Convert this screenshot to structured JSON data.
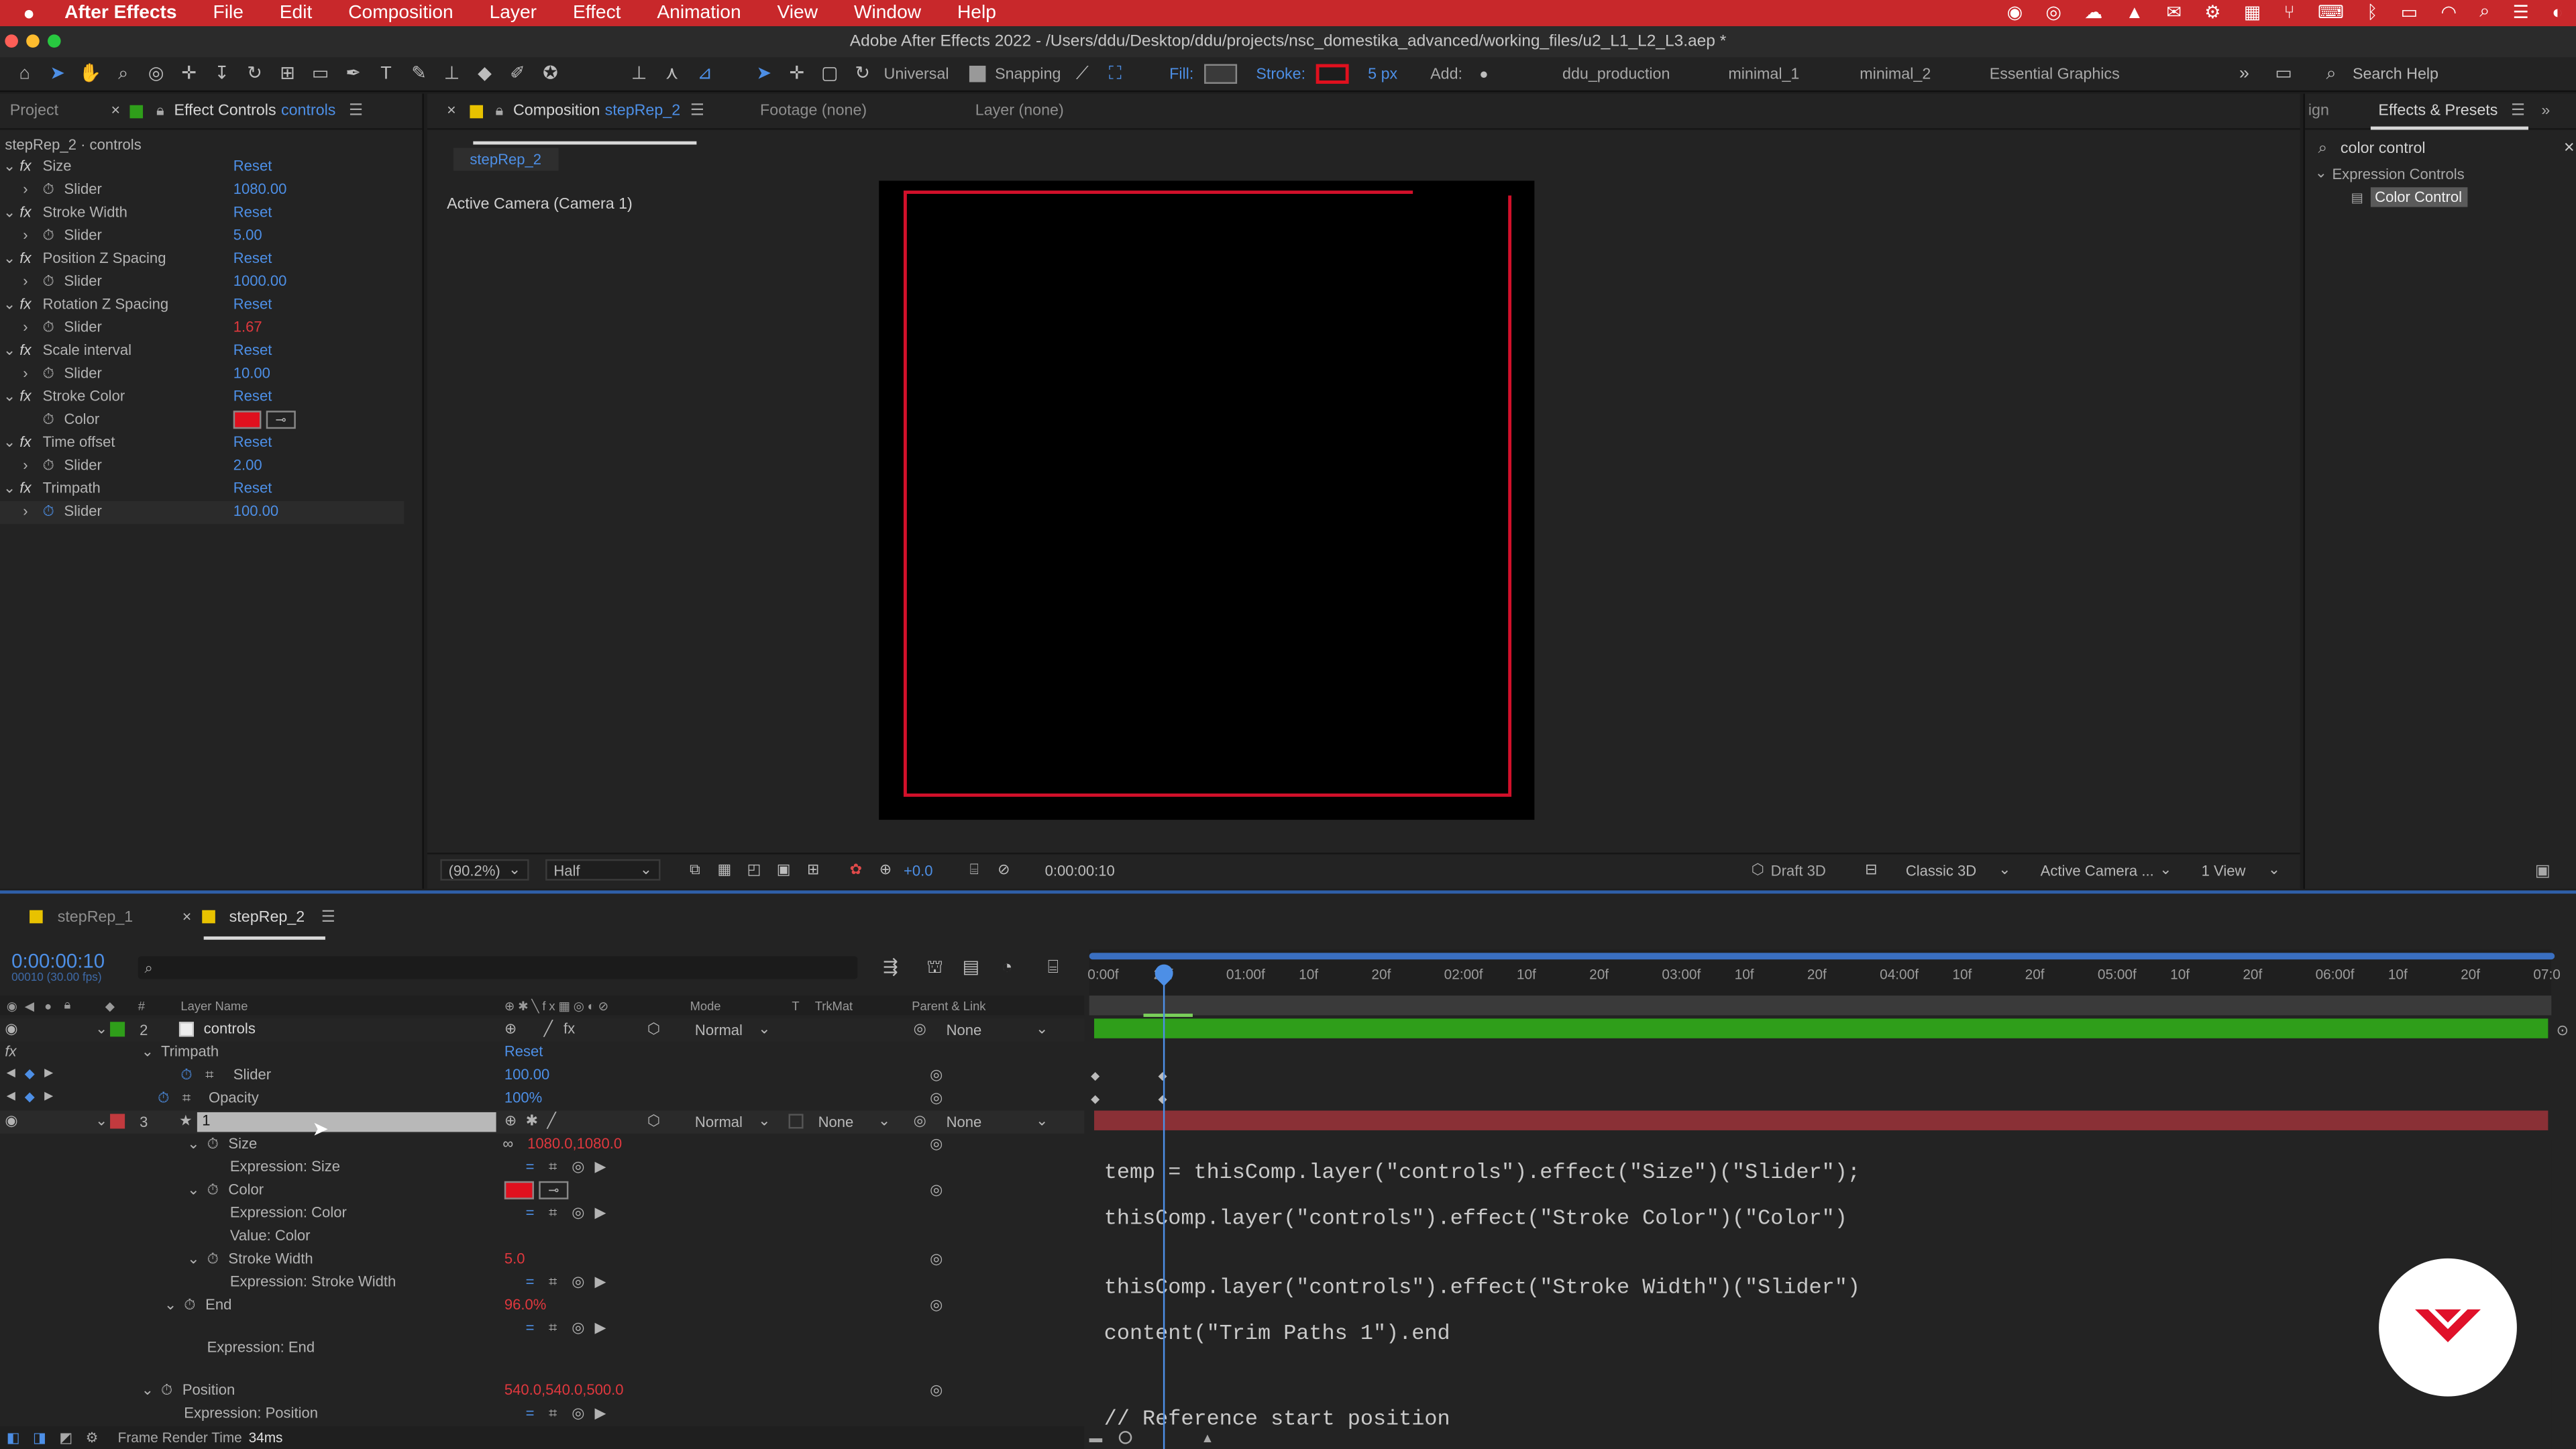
{
  "menubar": {
    "app_name": "After Effects",
    "items": [
      "File",
      "Edit",
      "Composition",
      "Layer",
      "Effect",
      "Animation",
      "View",
      "Window",
      "Help"
    ]
  },
  "titlebar": {
    "title": "Adobe After Effects 2022 - /Users/ddu/Desktop/ddu/projects/nsc_domestika_advanced/working_files/u2_L1_L2_L3.aep *"
  },
  "toolbar": {
    "universal": "Universal",
    "snapping": "Snapping",
    "fill_label": "Fill:",
    "stroke_label": "Stroke:",
    "stroke_width": "5 px",
    "add_label": "Add:",
    "workspaces": [
      "ddu_production",
      "minimal_1",
      "minimal_2",
      "Essential Graphics"
    ],
    "search_placeholder": "Search Help"
  },
  "left_panel": {
    "project_tab": "Project",
    "effect_controls_tab": "Effect Controls",
    "effect_controls_target": "controls",
    "breadcrumb": "stepRep_2 · controls",
    "effects": [
      {
        "name": "Size",
        "reset": "Reset",
        "param": "Slider",
        "value": "1080.00"
      },
      {
        "name": "Stroke Width",
        "reset": "Reset",
        "param": "Slider",
        "value": "5.00"
      },
      {
        "name": "Position Z Spacing",
        "reset": "Reset",
        "param": "Slider",
        "value": "1000.00"
      },
      {
        "name": "Rotation Z Spacing",
        "reset": "Reset",
        "param": "Slider",
        "value": "1.67"
      },
      {
        "name": "Scale interval",
        "reset": "Reset",
        "param": "Slider",
        "value": "10.00"
      },
      {
        "name": "Stroke Color",
        "reset": "Reset",
        "param": "Color",
        "value": ""
      },
      {
        "name": "Time offset",
        "reset": "Reset",
        "param": "Slider",
        "value": "2.00"
      },
      {
        "name": "Trimpath",
        "reset": "Reset",
        "param": "Slider",
        "value": "100.00"
      }
    ]
  },
  "viewer": {
    "comp_tab_prefix": "Composition",
    "comp_name": "stepRep_2",
    "footage_tab": "Footage (none)",
    "layer_tab": "Layer (none)",
    "comp_subtab": "stepRep_2",
    "camera_label": "Active Camera (Camera 1)",
    "zoom": "(90.2%)",
    "resolution": "Half",
    "exposure": "+0.0",
    "timecode": "0:00:00:10",
    "draft3d": "Draft 3D",
    "renderer": "Classic 3D",
    "camera_select": "Active Camera ...",
    "views": "1 View"
  },
  "effects_presets": {
    "tab_partial": "ign",
    "title": "Effects & Presets",
    "search_value": "color control",
    "category": "Expression Controls",
    "result": "Color Control"
  },
  "timeline": {
    "tabs": [
      "stepRep_1",
      "stepRep_2"
    ],
    "timecode": "0:00:00:10",
    "fps": "00010 (30.00 fps)",
    "col_layer_name": "Layer Name",
    "col_hash": "#",
    "col_mode": "Mode",
    "col_t": "T",
    "col_trkmat": "TrkMat",
    "col_parent": "Parent & Link",
    "ruler": [
      "0:00f",
      "20f",
      "01:00f",
      "10f",
      "20f",
      "02:00f",
      "10f",
      "20f",
      "03:00f",
      "10f",
      "20f",
      "04:00f",
      "10f",
      "20f",
      "05:00f",
      "10f",
      "20f",
      "06:00f",
      "10f",
      "20f",
      "07:0"
    ],
    "layer2": {
      "num": "2",
      "name": "controls",
      "mode": "Normal",
      "parent": "None"
    },
    "layer2_fx_label": "fx",
    "layer2_trimpath": "Trimpath",
    "layer2_trimpath_reset": "Reset",
    "layer2_slider": "Slider",
    "layer2_slider_value": "100.00",
    "layer2_opacity": "Opacity",
    "layer2_opacity_value": "100%",
    "layer3": {
      "num": "3",
      "name": "1",
      "mode": "Normal",
      "trkmat": "None",
      "parent": "None"
    },
    "props": [
      {
        "name": "Size",
        "value": "1080.0,1080.0"
      },
      {
        "name": "Expression: Size"
      },
      {
        "name": "Color"
      },
      {
        "name": "Expression: Color"
      },
      {
        "name": "Value: Color"
      },
      {
        "name": "Stroke Width",
        "value": "5.0"
      },
      {
        "name": "Expression: Stroke Width"
      },
      {
        "name": "End",
        "value": "96.0%"
      },
      {
        "name": "Expression: End"
      },
      {
        "name": "Position",
        "value": "540.0,540.0,500.0"
      },
      {
        "name": "Expression: Position"
      }
    ],
    "code": [
      "temp = thisComp.layer(\"controls\").effect(\"Size\")(\"Slider\");",
      "thisComp.layer(\"controls\").effect(\"Stroke Color\")(\"Color\")",
      "thisComp.layer(\"controls\").effect(\"Stroke Width\")(\"Slider\")",
      "content(\"Trim Paths 1\").end",
      "// Reference start position"
    ],
    "frame_render_label": "Frame Render Time",
    "frame_render_value": "34ms"
  },
  "colors": {
    "menubar": "#c8282b",
    "accent_blue": "#4d8fe6",
    "stroke_red": "#e0101e",
    "layer_green": "#2f9e1a",
    "layer_red": "#8a3036"
  }
}
